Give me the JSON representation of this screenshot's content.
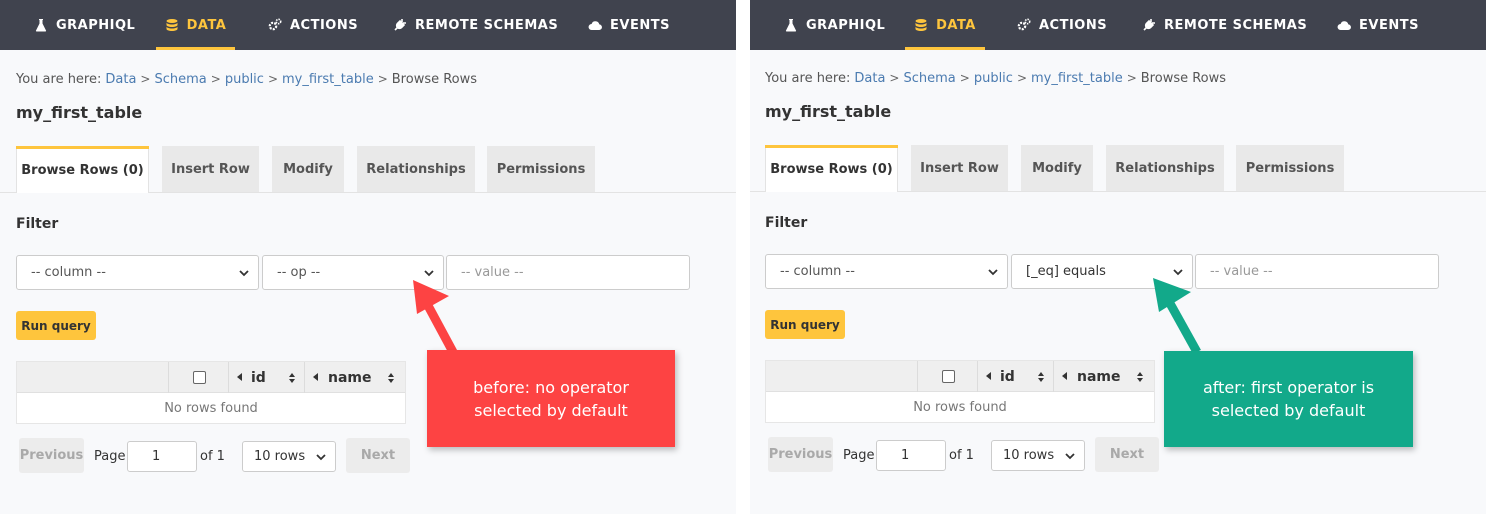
{
  "nav": {
    "items": [
      {
        "label": "GRAPHIQL",
        "icon": "flask-icon"
      },
      {
        "label": "DATA",
        "icon": "database-icon",
        "active": true
      },
      {
        "label": "ACTIONS",
        "icon": "gears-icon"
      },
      {
        "label": "REMOTE SCHEMAS",
        "icon": "plug-icon"
      },
      {
        "label": "EVENTS",
        "icon": "cloud-icon"
      }
    ]
  },
  "breadcrumb": {
    "prefix": "You are here:",
    "items": [
      "Data",
      "Schema",
      "public",
      "my_first_table"
    ],
    "current": "Browse Rows",
    "separator": ">"
  },
  "page_title": "my_first_table",
  "tabs": [
    "Browse Rows (0)",
    "Insert Row",
    "Modify",
    "Relationships",
    "Permissions"
  ],
  "filter": {
    "label": "Filter",
    "column_placeholder": "-- column --",
    "value_placeholder": "-- value --"
  },
  "left": {
    "operator_value": "-- op --",
    "callout": "before: no operator selected by default",
    "callout_color": "#fd4343"
  },
  "right": {
    "operator_value": "[_eq] equals",
    "callout": "after: first operator is selected by default",
    "callout_color": "#12a98a"
  },
  "run_query_label": "Run query",
  "table": {
    "columns": [
      "id",
      "name"
    ],
    "empty_text": "No rows found"
  },
  "pagination": {
    "previous_label": "Previous",
    "next_label": "Next",
    "page_label": "Page",
    "page_value": "1",
    "of_label": "of 1",
    "rows_option": "10 rows"
  },
  "colors": {
    "accent": "#fec53d",
    "nav_bg": "#40434e",
    "link": "#4b7bb0"
  }
}
